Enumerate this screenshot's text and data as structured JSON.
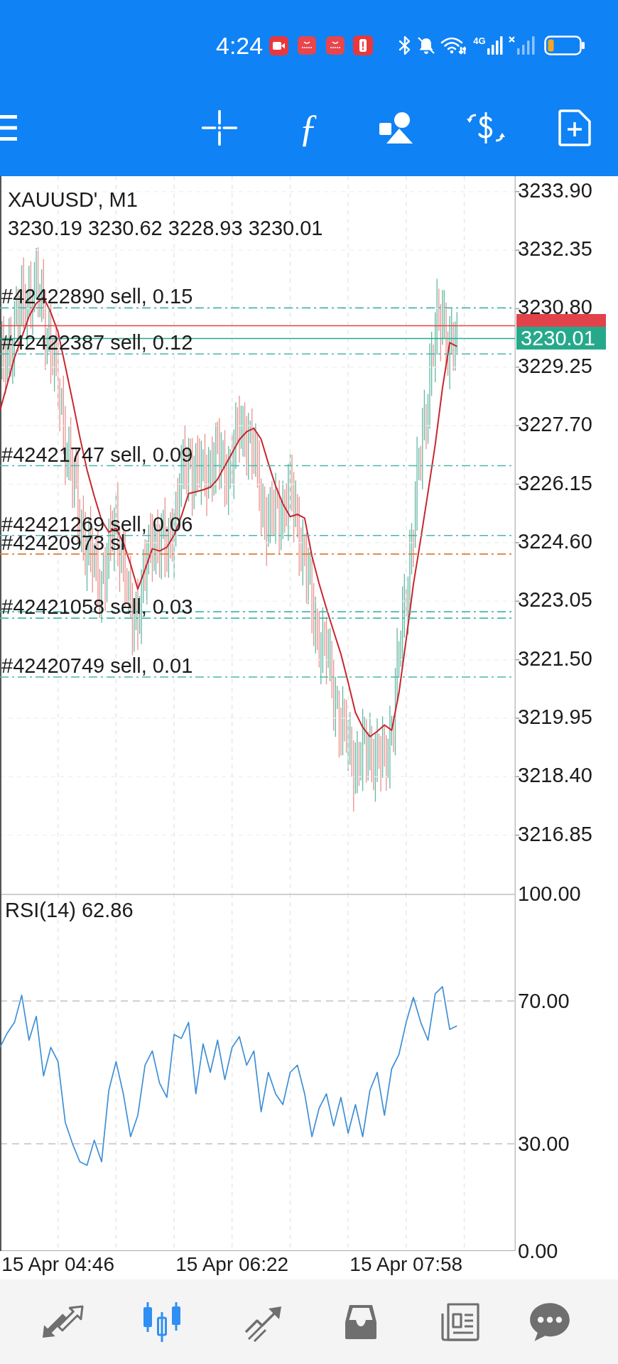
{
  "status_bar": {
    "time": "4:24",
    "network_type": "4G"
  },
  "toolbar": {
    "function_glyph": "ƒ"
  },
  "main_chart": {
    "ohlc": "3230.19 3230.62 3228.93 3230.01",
    "chart_data": {
      "type": "line",
      "title": "XAUUSD', M1",
      "grid": true,
      "ylim": [
        3215.3,
        3234.31
      ],
      "yticks": [
        {
          "value": 3233.9,
          "label": "3233.90"
        },
        {
          "value": 3232.35,
          "label": "3232.35"
        },
        {
          "value": 3230.8,
          "label": "3230.80"
        },
        {
          "value": 3229.25,
          "label": "3229.25"
        },
        {
          "value": 3227.7,
          "label": "3227.70"
        },
        {
          "value": 3226.15,
          "label": "3226.15"
        },
        {
          "value": 3224.6,
          "label": "3224.60"
        },
        {
          "value": 3223.05,
          "label": "3223.05"
        },
        {
          "value": 3221.5,
          "label": "3221.50"
        },
        {
          "value": 3219.95,
          "label": "3219.95"
        },
        {
          "value": 3218.4,
          "label": "3218.40"
        },
        {
          "value": 3216.85,
          "label": "3216.85"
        }
      ],
      "categories": [
        null,
        null,
        null,
        null,
        null,
        null,
        null,
        null,
        null,
        null,
        null,
        null,
        null,
        null,
        null,
        null,
        null,
        null,
        null,
        null,
        null,
        null,
        null,
        null,
        null,
        null,
        null,
        null,
        null,
        null,
        null,
        null,
        null,
        null,
        null,
        null,
        null,
        null,
        null,
        null,
        null,
        null,
        null,
        null,
        null,
        null,
        null,
        null,
        null,
        null,
        null,
        null,
        null,
        null,
        null,
        null,
        null,
        null,
        null,
        null,
        null,
        null,
        null,
        null,
        null,
        null,
        null,
        null,
        null,
        null,
        null,
        null
      ],
      "series": [
        {
          "color": "#c8262e",
          "values": [
            3228.1,
            3228.8,
            3229.5,
            3230.04,
            3230.59,
            3230.94,
            3231.1,
            3230.7,
            3230.18,
            3229.28,
            3228.36,
            3227.41,
            3226.53,
            3225.83,
            3225.19,
            3224.88,
            3224.98,
            3224.6,
            3224.03,
            3223.37,
            3223.89,
            3224.44,
            3224.38,
            3224.48,
            3224.8,
            3225.3,
            3225.9,
            3225.95,
            3226.0,
            3226.07,
            3226.28,
            3226.63,
            3226.98,
            3227.33,
            3227.54,
            3227.63,
            3227.34,
            3226.7,
            3226.1,
            3225.63,
            3225.29,
            3225.35,
            3225.25,
            3224.25,
            3223.51,
            3222.86,
            3222.25,
            3221.65,
            3220.9,
            3220.1,
            3219.71,
            3219.46,
            3219.6,
            3219.77,
            3219.63,
            3220.62,
            3222.03,
            3223.5,
            3224.7,
            3225.93,
            3227.2,
            3228.7,
            3229.9,
            3229.8,
            null,
            null,
            null,
            null,
            null,
            null,
            null,
            null
          ]
        }
      ],
      "ref_lines": [
        {
          "axis": "y",
          "value": 3230.82,
          "color": "#4db6ac",
          "label": "#42422890 sell, 0.15"
        },
        {
          "axis": "y",
          "value": 3229.6,
          "color": "#4db6ac",
          "label": "#42422387 sell, 0.12"
        },
        {
          "axis": "y",
          "value": 3226.64,
          "color": "#4db6ac",
          "label": "#42421747 sell, 0.09"
        },
        {
          "axis": "y",
          "value": 3224.79,
          "color": "#4db6ac",
          "label": "#42421269 sell, 0.06"
        },
        {
          "axis": "y",
          "value": 3224.3,
          "color": "#e07b39",
          "label": "#42420973 sl"
        },
        {
          "axis": "y",
          "value": 3222.77,
          "color": "#4db6ac"
        },
        {
          "axis": "y",
          "value": 3222.6,
          "color": "#4db6ac",
          "label": "#42421058 sell, 0.03"
        },
        {
          "axis": "y",
          "value": 3221.04,
          "color": "#4db6ac",
          "label": "#42420749 sell, 0.01"
        },
        {
          "axis": "y",
          "value": 3230.35,
          "color": "#e2434b"
        },
        {
          "axis": "y",
          "value": 3230.01,
          "color": "#26a98b",
          "label": "3230.01"
        }
      ]
    }
  },
  "rsi_chart": {
    "chart_data": {
      "type": "line",
      "title": "RSI(14) 62.86",
      "grid": true,
      "ylim": [
        0,
        100
      ],
      "yticks": [
        {
          "value": 100,
          "label": "100.00"
        },
        {
          "value": 70,
          "label": "70.00"
        },
        {
          "value": 30,
          "label": "30.00"
        },
        {
          "value": 0,
          "label": "0.00"
        }
      ],
      "categories": [
        null,
        null,
        null,
        null,
        null,
        null,
        null,
        null,
        "15 Apr 04:46",
        null,
        null,
        null,
        null,
        null,
        null,
        null,
        null,
        null,
        null,
        null,
        null,
        null,
        null,
        null,
        null,
        null,
        null,
        null,
        null,
        null,
        null,
        null,
        "15 Apr 06:22",
        null,
        null,
        null,
        null,
        null,
        null,
        null,
        null,
        null,
        null,
        null,
        null,
        null,
        null,
        null,
        null,
        null,
        null,
        null,
        null,
        null,
        null,
        null,
        "15 Apr 07:58",
        null,
        null,
        null,
        null,
        null,
        null,
        null,
        null,
        null,
        null,
        null,
        null,
        null,
        null,
        null
      ],
      "series": [
        {
          "color": "#3f8fd6",
          "values": [
            57,
            61,
            64,
            71.6,
            59,
            65.7,
            49,
            57,
            53,
            36,
            30,
            25,
            24,
            31,
            25,
            45,
            53,
            44,
            32,
            38,
            52,
            56,
            47,
            43,
            60.6,
            59.5,
            64,
            44,
            58,
            50,
            59,
            48,
            57,
            60,
            52,
            56,
            39,
            50,
            44,
            41,
            50,
            52,
            44,
            32,
            40,
            44,
            35,
            43,
            33,
            41,
            32,
            45,
            50,
            38,
            51,
            55,
            64,
            71,
            64,
            59,
            72,
            74,
            62,
            63,
            null,
            null,
            null,
            null,
            null,
            null,
            null,
            null
          ]
        }
      ]
    }
  },
  "bottom_nav": [
    {
      "selected": false
    },
    {
      "selected": true
    },
    {
      "selected": false
    },
    {
      "selected": false
    },
    {
      "selected": false
    },
    {
      "selected": false
    }
  ]
}
